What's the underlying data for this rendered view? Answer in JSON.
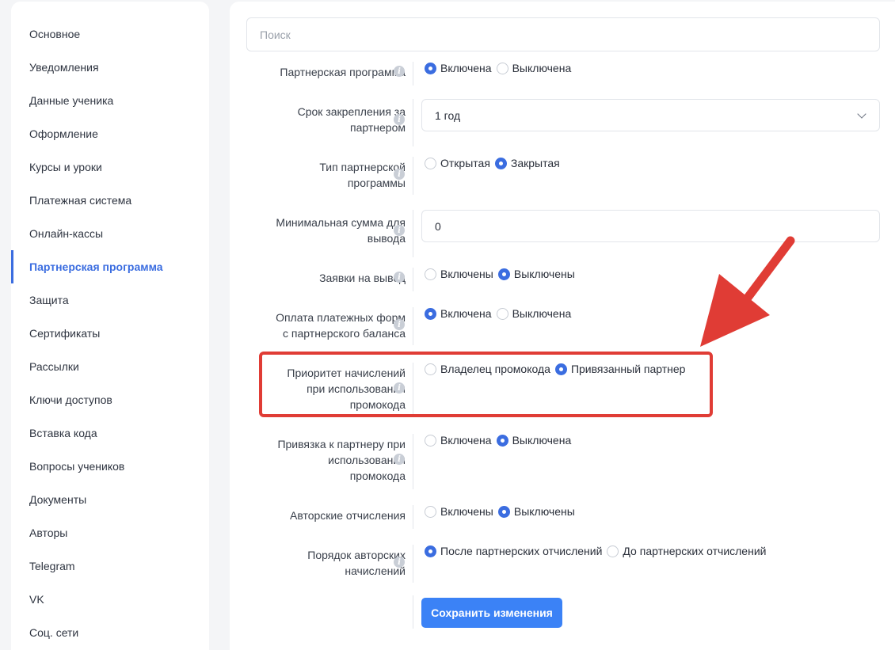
{
  "sidebar": {
    "items": [
      {
        "label": "Основное"
      },
      {
        "label": "Уведомления"
      },
      {
        "label": "Данные ученика"
      },
      {
        "label": "Оформление"
      },
      {
        "label": "Курсы и уроки"
      },
      {
        "label": "Платежная система"
      },
      {
        "label": "Онлайн-кассы"
      },
      {
        "label": "Партнерская программа",
        "active": true
      },
      {
        "label": "Защита"
      },
      {
        "label": "Сертификаты"
      },
      {
        "label": "Рассылки"
      },
      {
        "label": "Ключи доступов"
      },
      {
        "label": "Вставка кода"
      },
      {
        "label": "Вопросы учеников"
      },
      {
        "label": "Документы"
      },
      {
        "label": "Авторы"
      },
      {
        "label": "Telegram"
      },
      {
        "label": "VK"
      },
      {
        "label": "Соц. сети"
      }
    ]
  },
  "search": {
    "placeholder": "Поиск",
    "value": ""
  },
  "settings": {
    "partner_program": {
      "label": "Партнерская программа",
      "options": [
        "Включена",
        "Выключена"
      ],
      "selected": 0
    },
    "binding_term": {
      "label_lines": [
        "Срок закрепления за",
        "партнером"
      ],
      "value": "1 год"
    },
    "program_type": {
      "label_lines": [
        "Тип партнерской",
        "программы"
      ],
      "options": [
        "Открытая",
        "Закрытая"
      ],
      "selected": 1
    },
    "min_withdraw": {
      "label_lines": [
        "Минимальная сумма для",
        "вывода"
      ],
      "value": "0"
    },
    "withdraw_requests": {
      "label": "Заявки на вывод",
      "options": [
        "Включены",
        "Выключены"
      ],
      "selected": 1
    },
    "balance_payment": {
      "label_lines": [
        "Оплата платежных форм",
        "с партнерского баланса"
      ],
      "options": [
        "Включена",
        "Выключена"
      ],
      "selected": 0
    },
    "promo_priority": {
      "label_lines": [
        "Приоритет начислений",
        "при использовании",
        "промокода"
      ],
      "options": [
        "Владелец промокода",
        "Привязанный партнер"
      ],
      "selected": 1
    },
    "promo_binding": {
      "label_lines": [
        "Привязка к партнеру при",
        "использовании",
        "промокода"
      ],
      "options": [
        "Включена",
        "Выключена"
      ],
      "selected": 1
    },
    "author_fees": {
      "label": "Авторские отчисления",
      "options": [
        "Включены",
        "Выключены"
      ],
      "selected": 1
    },
    "author_order": {
      "label_lines": [
        "Порядок авторских",
        "начислений"
      ],
      "options": [
        "После партнерских отчислений",
        "До партнерских отчислений"
      ],
      "selected": 0
    }
  },
  "save_button": {
    "label": "Сохранить изменения"
  },
  "colors": {
    "accent": "#3b6de0",
    "button": "#3b82f6",
    "annotation": "#e03c35"
  }
}
